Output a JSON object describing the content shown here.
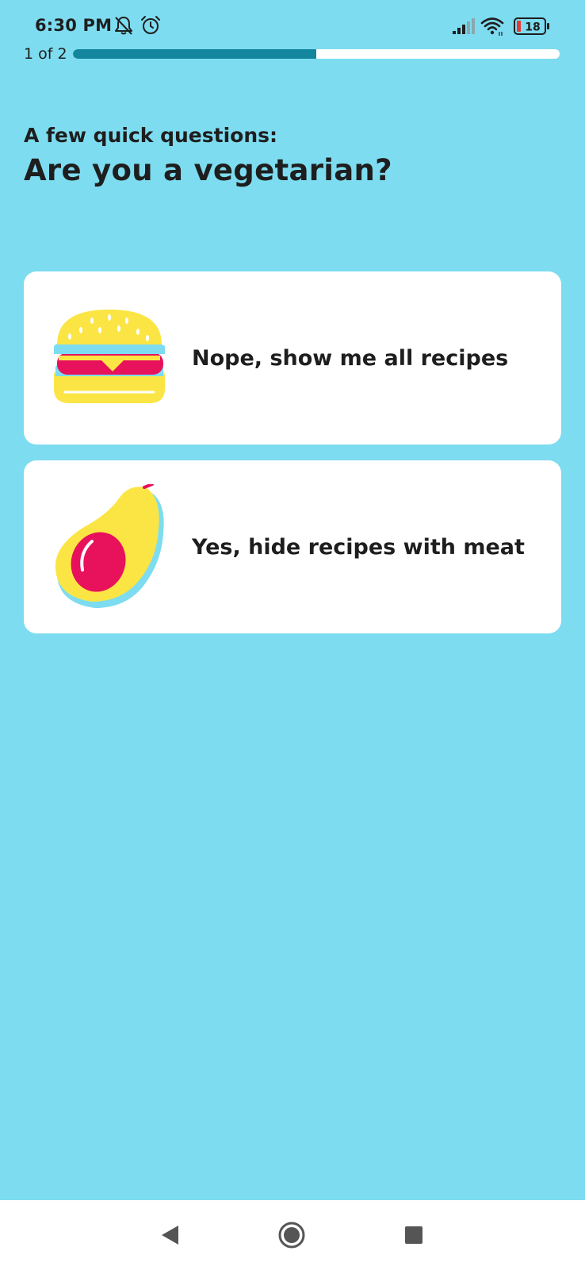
{
  "status_bar": {
    "time": "6:30 PM",
    "battery_level": "18",
    "icons": [
      "bell-off-icon",
      "alarm-icon",
      "signal-icon",
      "wifi-icon",
      "battery-icon"
    ]
  },
  "progress": {
    "label": "1 of 2",
    "fraction": 0.5,
    "fill_color": "#13869e"
  },
  "header": {
    "subtitle": "A few quick questions:",
    "title": "Are you a vegetarian?"
  },
  "options": [
    {
      "label": "Nope, show me all recipes",
      "icon": "burger-icon"
    },
    {
      "label": "Yes, hide recipes with meat",
      "icon": "avocado-icon"
    }
  ],
  "nav_bar": {
    "icons": [
      "back-icon",
      "home-icon",
      "recents-icon"
    ]
  },
  "colors": {
    "background": "#7ddcf0",
    "card": "#ffffff",
    "accent_yellow": "#fbe544",
    "accent_pink": "#e8115b"
  }
}
